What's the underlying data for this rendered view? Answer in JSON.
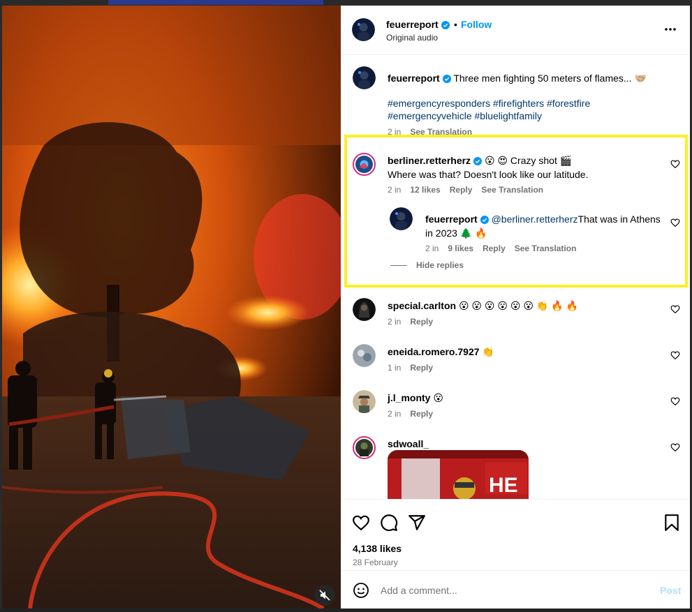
{
  "header": {
    "username": "feuerreport",
    "separator": "•",
    "follow_label": "Follow",
    "audio": "Original audio"
  },
  "caption": {
    "username": "feuerreport",
    "text": "Three men fighting 50 meters of flames... 🤝🏼",
    "hashtags_line1": "#emergencyresponders #firefighters #forestfire",
    "hashtags_line2": "#emergencyvehicle #bluelightfamily",
    "time": "2 in",
    "see_translation": "See Translation"
  },
  "comments": [
    {
      "username": "berliner.retterherz",
      "text_line1": " 😮 😍 Crazy shot 🎬",
      "text_line2": "Where was that? Doesn't look like our latitude.",
      "time": "2 in",
      "likes": "12 likes",
      "reply": "Reply",
      "see_translation": "See Translation",
      "reply_item": {
        "username": "feuerreport",
        "mention": "@berliner.retterherz",
        "text_line1": "That was in Athens",
        "text_line2": "in 2023 🌲 🔥",
        "time": "2 in",
        "likes": "9 likes",
        "reply": "Reply",
        "see_translation": "See Translation"
      },
      "hide_replies": "Hide replies"
    },
    {
      "username": "special.carlton",
      "text": "😮 😮 😮 😮 😮 😮 👏 🔥 🔥",
      "time": "2 in",
      "reply": "Reply"
    },
    {
      "username": "eneida.romero.7927",
      "text": "👏",
      "time": "1 in",
      "reply": "Reply"
    },
    {
      "username": "j.l_monty",
      "text": "😮",
      "time": "2 in",
      "reply": "Reply"
    },
    {
      "username": "sdwoall_",
      "text": ""
    }
  ],
  "actions": {
    "likes": "4,138 likes",
    "date": "28 February"
  },
  "add_comment": {
    "placeholder": "Add a comment...",
    "post_label": "Post"
  },
  "icons": {
    "verified": "verified-badge-icon",
    "more": "more-options-icon",
    "heart": "heart-icon",
    "comment": "comment-icon",
    "share": "share-icon",
    "save": "bookmark-icon",
    "emoji": "emoji-icon",
    "mute": "muted-speaker-icon"
  },
  "colors": {
    "link": "#0095f6",
    "hashtag": "#00376b",
    "highlight": "#fbf026",
    "verified": "#0095f6"
  }
}
